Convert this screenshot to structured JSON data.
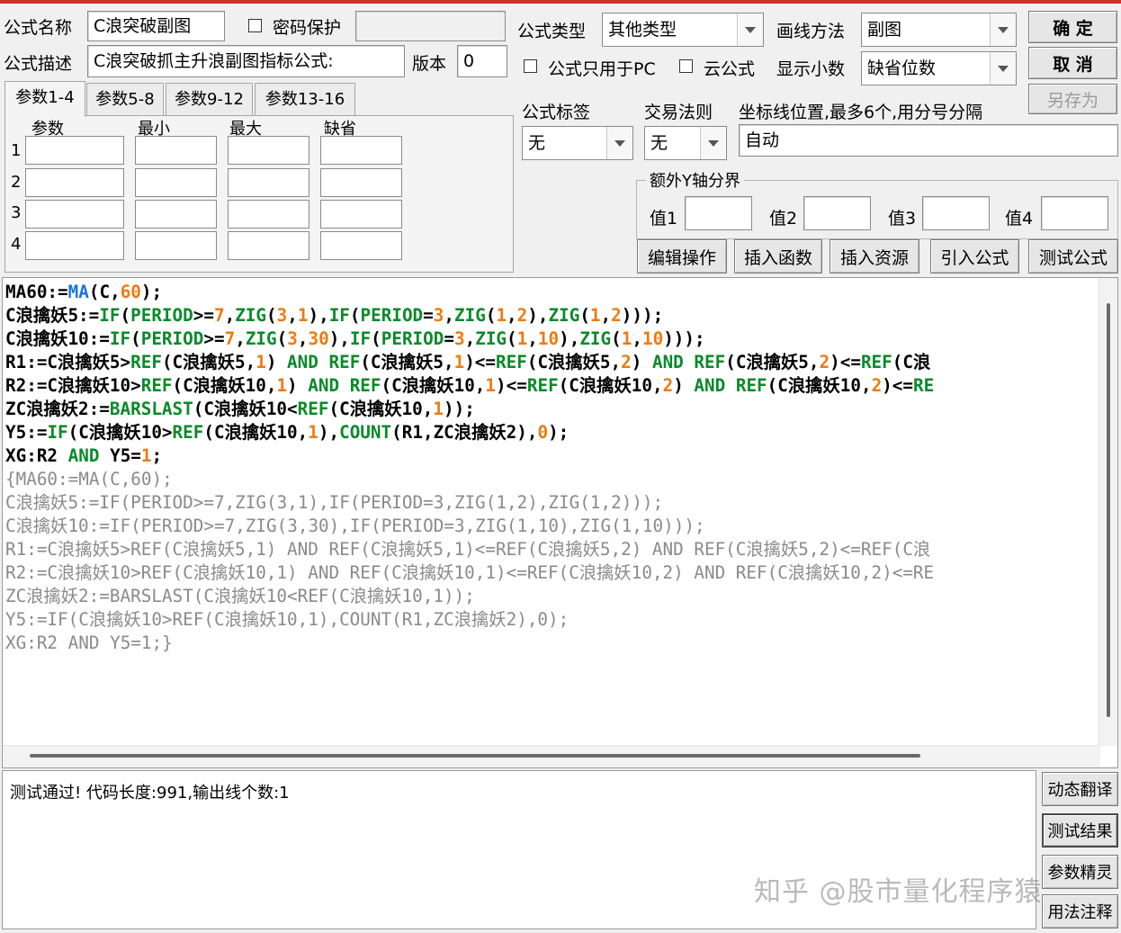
{
  "form": {
    "name_label": "公式名称",
    "name_value": "C浪突破副图",
    "password_label": "密码保护",
    "password_value": "",
    "desc_label": "公式描述",
    "desc_value": "C浪突破抓主升浪副图指标公式:",
    "version_label": "版本",
    "version_value": "0",
    "type_label": "公式类型",
    "type_value": "其他类型",
    "draw_label": "画线方法",
    "draw_value": "副图",
    "pc_only_label": "公式只用于PC",
    "cloud_label": "云公式",
    "decimals_label": "显示小数",
    "decimals_value": "缺省位数",
    "tag_label": "公式标签",
    "tag_value": "无",
    "rule_label": "交易法则",
    "rule_value": "无",
    "axis_label": "坐标线位置,最多6个,用分号分隔",
    "axis_value": "自动",
    "yaxis_group_label": "额外Y轴分界",
    "y_labels": [
      "值1",
      "值2",
      "值3",
      "值4"
    ]
  },
  "buttons": {
    "ok": "确  定",
    "cancel": "取  消",
    "save_as": "另存为",
    "edit_ops": "编辑操作",
    "insert_func": "插入函数",
    "insert_res": "插入资源",
    "import_formula": "引入公式",
    "test_formula": "测试公式",
    "dyn_translate": "动态翻译",
    "test_result": "测试结果",
    "param_wizard": "参数精灵",
    "usage_notes": "用法注释"
  },
  "tabs": [
    "参数1-4",
    "参数5-8",
    "参数9-12",
    "参数13-16"
  ],
  "params": {
    "headers": [
      "参数",
      "最小",
      "最大",
      "缺省"
    ],
    "rows": [
      "1",
      "2",
      "3",
      "4"
    ]
  },
  "code_lines": [
    [
      [
        "MA60:=",
        "id"
      ],
      [
        "MA",
        "fnb"
      ],
      [
        "(",
        "op"
      ],
      [
        "C",
        "id"
      ],
      [
        ",",
        "op"
      ],
      [
        "60",
        "num"
      ],
      [
        ");",
        "op"
      ]
    ],
    [
      [
        "C浪擒妖5:=",
        "id"
      ],
      [
        "IF",
        "fn"
      ],
      [
        "(",
        "op"
      ],
      [
        "PERIOD",
        "fn"
      ],
      [
        ">=",
        "op"
      ],
      [
        "7",
        "num"
      ],
      [
        ",",
        "op"
      ],
      [
        "ZIG",
        "fn"
      ],
      [
        "(",
        "op"
      ],
      [
        "3",
        "num"
      ],
      [
        ",",
        "op"
      ],
      [
        "1",
        "num"
      ],
      [
        "),",
        "op"
      ],
      [
        "IF",
        "fn"
      ],
      [
        "(",
        "op"
      ],
      [
        "PERIOD",
        "fn"
      ],
      [
        "=",
        "op"
      ],
      [
        "3",
        "num"
      ],
      [
        ",",
        "op"
      ],
      [
        "ZIG",
        "fn"
      ],
      [
        "(",
        "op"
      ],
      [
        "1",
        "num"
      ],
      [
        ",",
        "op"
      ],
      [
        "2",
        "num"
      ],
      [
        "),",
        "op"
      ],
      [
        "ZIG",
        "fn"
      ],
      [
        "(",
        "op"
      ],
      [
        "1",
        "num"
      ],
      [
        ",",
        "op"
      ],
      [
        "2",
        "num"
      ],
      [
        ")));",
        "op"
      ]
    ],
    [
      [
        "C浪擒妖10:=",
        "id"
      ],
      [
        "IF",
        "fn"
      ],
      [
        "(",
        "op"
      ],
      [
        "PERIOD",
        "fn"
      ],
      [
        ">=",
        "op"
      ],
      [
        "7",
        "num"
      ],
      [
        ",",
        "op"
      ],
      [
        "ZIG",
        "fn"
      ],
      [
        "(",
        "op"
      ],
      [
        "3",
        "num"
      ],
      [
        ",",
        "op"
      ],
      [
        "30",
        "num"
      ],
      [
        "),",
        "op"
      ],
      [
        "IF",
        "fn"
      ],
      [
        "(",
        "op"
      ],
      [
        "PERIOD",
        "fn"
      ],
      [
        "=",
        "op"
      ],
      [
        "3",
        "num"
      ],
      [
        ",",
        "op"
      ],
      [
        "ZIG",
        "fn"
      ],
      [
        "(",
        "op"
      ],
      [
        "1",
        "num"
      ],
      [
        ",",
        "op"
      ],
      [
        "10",
        "num"
      ],
      [
        "),",
        "op"
      ],
      [
        "ZIG",
        "fn"
      ],
      [
        "(",
        "op"
      ],
      [
        "1",
        "num"
      ],
      [
        ",",
        "op"
      ],
      [
        "10",
        "num"
      ],
      [
        ")));",
        "op"
      ]
    ],
    [
      [
        "R1:=C浪擒妖5>",
        "id"
      ],
      [
        "REF",
        "fn"
      ],
      [
        "(C浪擒妖5,",
        "id"
      ],
      [
        "1",
        "num"
      ],
      [
        ") ",
        "op"
      ],
      [
        "AND",
        "kw"
      ],
      [
        " ",
        "op"
      ],
      [
        "REF",
        "fn"
      ],
      [
        "(C浪擒妖5,",
        "id"
      ],
      [
        "1",
        "num"
      ],
      [
        ")<=",
        "op"
      ],
      [
        "REF",
        "fn"
      ],
      [
        "(C浪擒妖5,",
        "id"
      ],
      [
        "2",
        "num"
      ],
      [
        ") ",
        "op"
      ],
      [
        "AND",
        "kw"
      ],
      [
        " ",
        "op"
      ],
      [
        "REF",
        "fn"
      ],
      [
        "(C浪擒妖5,",
        "id"
      ],
      [
        "2",
        "num"
      ],
      [
        ")<=",
        "op"
      ],
      [
        "REF",
        "fn"
      ],
      [
        "(C浪",
        "id"
      ]
    ],
    [
      [
        "R2:=C浪擒妖10>",
        "id"
      ],
      [
        "REF",
        "fn"
      ],
      [
        "(C浪擒妖10,",
        "id"
      ],
      [
        "1",
        "num"
      ],
      [
        ") ",
        "op"
      ],
      [
        "AND",
        "kw"
      ],
      [
        " ",
        "op"
      ],
      [
        "REF",
        "fn"
      ],
      [
        "(C浪擒妖10,",
        "id"
      ],
      [
        "1",
        "num"
      ],
      [
        ")<=",
        "op"
      ],
      [
        "REF",
        "fn"
      ],
      [
        "(C浪擒妖10,",
        "id"
      ],
      [
        "2",
        "num"
      ],
      [
        ") ",
        "op"
      ],
      [
        "AND",
        "kw"
      ],
      [
        " ",
        "op"
      ],
      [
        "REF",
        "fn"
      ],
      [
        "(C浪擒妖10,",
        "id"
      ],
      [
        "2",
        "num"
      ],
      [
        ")<=",
        "op"
      ],
      [
        "RE",
        "fn"
      ]
    ],
    [
      [
        "ZC浪擒妖2:=",
        "id"
      ],
      [
        "BARSLAST",
        "fn"
      ],
      [
        "(C浪擒妖10<",
        "id"
      ],
      [
        "REF",
        "fn"
      ],
      [
        "(C浪擒妖10,",
        "id"
      ],
      [
        "1",
        "num"
      ],
      [
        "));",
        "op"
      ]
    ],
    [
      [
        "Y5:=",
        "id"
      ],
      [
        "IF",
        "fn"
      ],
      [
        "(C浪擒妖10>",
        "id"
      ],
      [
        "REF",
        "fn"
      ],
      [
        "(C浪擒妖10,",
        "id"
      ],
      [
        "1",
        "num"
      ],
      [
        "),",
        "op"
      ],
      [
        "COUNT",
        "fn"
      ],
      [
        "(R1,ZC浪擒妖2),",
        "id"
      ],
      [
        "0",
        "num"
      ],
      [
        ");",
        "op"
      ]
    ],
    [
      [
        "XG:R2 ",
        "id"
      ],
      [
        "AND",
        "kw"
      ],
      [
        " Y5=",
        "id"
      ],
      [
        "1",
        "num"
      ],
      [
        ";",
        "op"
      ]
    ]
  ],
  "comment_lines": [
    "{MA60:=MA(C,60);",
    "C浪擒妖5:=IF(PERIOD>=7,ZIG(3,1),IF(PERIOD=3,ZIG(1,2),ZIG(1,2)));",
    "C浪擒妖10:=IF(PERIOD>=7,ZIG(3,30),IF(PERIOD=3,ZIG(1,10),ZIG(1,10)));",
    "R1:=C浪擒妖5>REF(C浪擒妖5,1) AND REF(C浪擒妖5,1)<=REF(C浪擒妖5,2) AND REF(C浪擒妖5,2)<=REF(C浪",
    "R2:=C浪擒妖10>REF(C浪擒妖10,1) AND REF(C浪擒妖10,1)<=REF(C浪擒妖10,2) AND REF(C浪擒妖10,2)<=RE",
    "ZC浪擒妖2:=BARSLAST(C浪擒妖10<REF(C浪擒妖10,1));",
    "Y5:=IF(C浪擒妖10>REF(C浪擒妖10,1),COUNT(R1,ZC浪擒妖2),0);",
    "XG:R2 AND Y5=1;}"
  ],
  "output": {
    "message": "测试通过! 代码长度:991,输出线个数:1"
  },
  "watermark": "知乎 @股市量化程序猿",
  "colors": {
    "function": "#0a8a2a",
    "builtin": "#1a74d8",
    "number": "#ee7a10",
    "comment": "#8a8a8a",
    "title_bar": "#c8342c"
  }
}
